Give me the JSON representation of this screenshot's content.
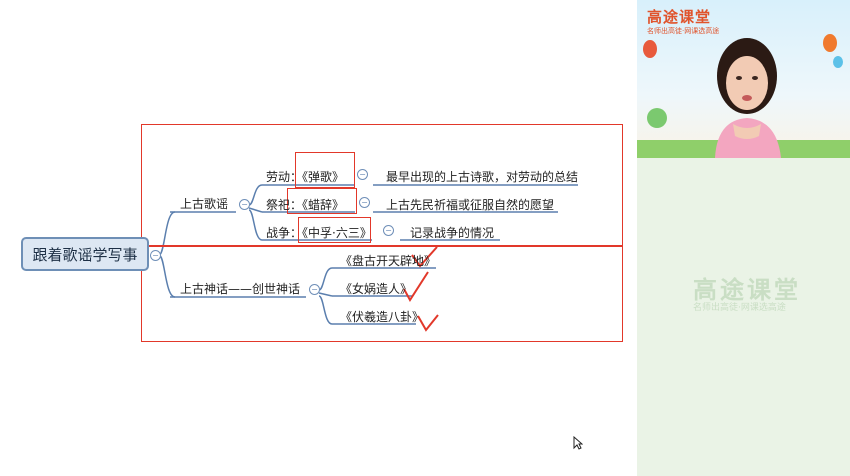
{
  "root": {
    "label": "跟着歌谣学写事"
  },
  "branches": [
    {
      "label": "上古歌谣",
      "children": [
        {
          "prefix": "劳动：",
          "title": "《弹歌》",
          "desc": "最早出现的上古诗歌，对劳动的总结"
        },
        {
          "prefix": "祭祀：",
          "title": "《蜡辞》",
          "desc": "上古先民祈福或征服自然的愿望"
        },
        {
          "prefix": "战争：",
          "title": "《中孚·六三》",
          "desc": "记录战争的情况"
        }
      ]
    },
    {
      "label": "上古神话——创世神话",
      "children": [
        {
          "title": "《盘古开天辟地》"
        },
        {
          "title": "《女娲造人》"
        },
        {
          "title": "《伏羲造八卦》"
        }
      ]
    }
  ],
  "sidebar": {
    "logo": "高途课堂",
    "slogan": "名师出高徒·网课选高途"
  },
  "colors": {
    "branch_line": "#5b7fae",
    "annotation_red": "#e2382a",
    "root_fill": "#dde7f3"
  }
}
